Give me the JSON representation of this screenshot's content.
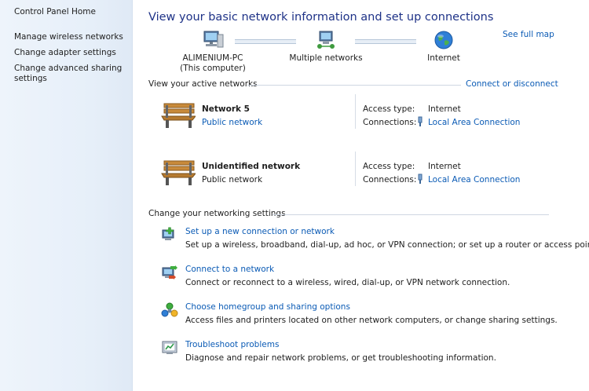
{
  "sidebar": {
    "home": "Control Panel Home",
    "links": [
      "Manage wireless networks",
      "Change adapter settings",
      "Change advanced sharing settings"
    ]
  },
  "header": {
    "title": "View your basic network information and set up connections",
    "see_full_map": "See full map"
  },
  "map": {
    "computer_name": "ALIMENIUM-PC",
    "computer_sub": "(This computer)",
    "middle": "Multiple networks",
    "internet": "Internet"
  },
  "active": {
    "label": "View your active networks",
    "connect_link": "Connect or disconnect",
    "networks": [
      {
        "name": "Network  5",
        "kind": "Public network",
        "kind_is_link": true,
        "access_label": "Access type:",
        "access_value": "Internet",
        "conn_label": "Connections:",
        "conn_value": "Local Area Connection"
      },
      {
        "name": "Unidentified network",
        "kind": "Public network",
        "kind_is_link": false,
        "access_label": "Access type:",
        "access_value": "Internet",
        "conn_label": "Connections:",
        "conn_value": "Local Area Connection"
      }
    ]
  },
  "settings": {
    "label": "Change your networking settings",
    "tasks": [
      {
        "link": "Set up a new connection or network",
        "desc": "Set up a wireless, broadband, dial-up, ad hoc, or VPN connection; or set up a router or access point.",
        "icon": "new-connection-icon"
      },
      {
        "link": "Connect to a network",
        "desc": "Connect or reconnect to a wireless, wired, dial-up, or VPN network connection.",
        "icon": "connect-network-icon"
      },
      {
        "link": "Choose homegroup and sharing options",
        "desc": "Access files and printers located on other network computers, or change sharing settings.",
        "icon": "homegroup-icon"
      },
      {
        "link": "Troubleshoot problems",
        "desc": "Diagnose and repair network problems, or get troubleshooting information.",
        "icon": "troubleshoot-icon"
      }
    ]
  },
  "colors": {
    "title": "#1e3287",
    "link": "#0b5bb5",
    "sidebar_bg": "#e6eff9"
  }
}
